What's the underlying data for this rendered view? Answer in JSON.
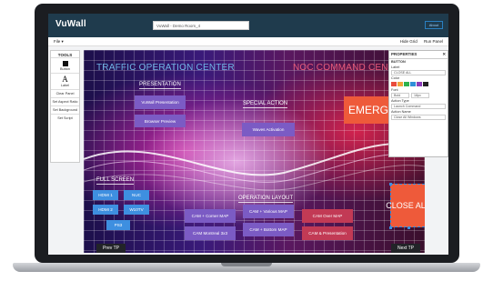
{
  "app": {
    "logo": "VuWall",
    "title_value": "VuWall - Demo Room_4",
    "about_label": "About"
  },
  "menu": {
    "file": "File",
    "hide_grid": "Hide Grid",
    "run_panel": "Run Panel"
  },
  "tools": {
    "title": "TOOLS",
    "items": [
      {
        "label": "Button"
      },
      {
        "label": "Label"
      },
      {
        "label": "Clear Panel"
      },
      {
        "label": "Set Aspect Ratio"
      },
      {
        "label": "Set Background"
      },
      {
        "label": "Set Script"
      }
    ]
  },
  "canvas": {
    "header_left": "TRAFFIC OPERATION CENTER",
    "header_right": "NOC COMMAND CENTER",
    "sections": {
      "presentation": "PRESENTATION",
      "special_action": "SPECIAL ACTION",
      "full_screen": "FULL SCREEN",
      "operation_layout": "OPERATION LAYOUT"
    },
    "buttons": {
      "vuwall_presentation": "VuWall Presentation",
      "browser_preview": "Browser Preview",
      "waves_activation": "Waves Activation",
      "hdmi1": "HDMI 1",
      "nuc": "NUC",
      "hdmi2": "HDMI 2",
      "w10tv": "W10TV",
      "ps3": "PS3",
      "cam_corner_map": "CAM + Corner MAP",
      "cam_various_map": "CAM + Various MAP",
      "cam_over_map": "CAM Over MAP",
      "cam_montreal": "CAM Montreal 3x3",
      "cam_bottom_map": "CAM + Bottom MAP",
      "cam_presentation": "CAM & Presentation",
      "emergency": "EMERGENCY",
      "close_all": "CLOSE ALL",
      "prev_tp": "Prev TP",
      "next_tp": "Next TP"
    }
  },
  "properties": {
    "title": "PROPERTIES",
    "close_glyph": "✕",
    "section": "BUTTON",
    "label_caption": "Label",
    "label_value": "CLOSE ALL",
    "color_caption": "Color",
    "swatches": [
      "#e94b3c",
      "#f2a33a",
      "#2fb24c",
      "#2f8fd8",
      "#8b3ab8",
      "#222222"
    ],
    "font_caption": "Font",
    "font_name": "Bold",
    "font_size": "18px",
    "action_type_caption": "Action Type",
    "action_type_value": "Launch Command",
    "action_name_caption": "Action Name",
    "action_name_value": "Close All Windows"
  },
  "colors": {
    "header_left": "#6fb4e6",
    "header_right": "#e85a7a",
    "purple_button": "#7b5bc4",
    "blue_button": "#3e8fe0",
    "red_button": "#c23a55",
    "accent": "#ee5a3a"
  }
}
